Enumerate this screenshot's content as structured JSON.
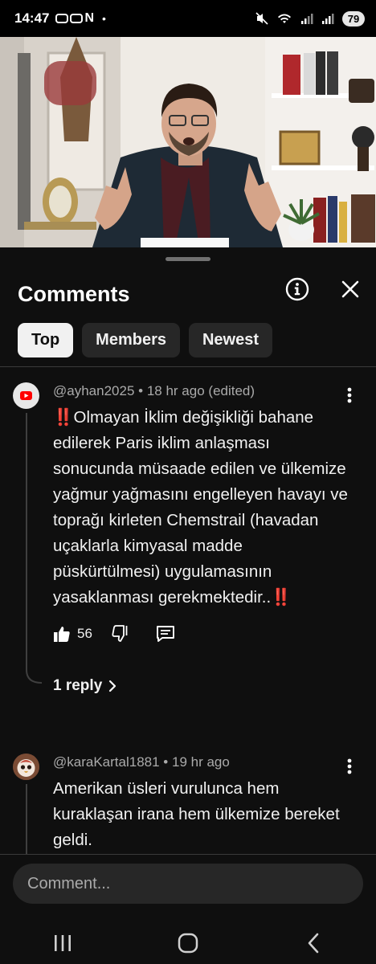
{
  "status_bar": {
    "time": "14:47",
    "app_glyphs": "N",
    "dot": "•",
    "battery": "79"
  },
  "sheet": {
    "title": "Comments",
    "tabs": [
      {
        "label": "Top",
        "active": true
      },
      {
        "label": "Members",
        "active": false
      },
      {
        "label": "Newest",
        "active": false
      }
    ]
  },
  "comments": [
    {
      "author": "@ayhan2025",
      "age": "18 hr ago",
      "edited": "(edited)",
      "emoji_lead": "‼️",
      "text": "Olmayan İklim değişikliği bahane edilerek Paris iklim anlaşması sonucunda müsaade edilen ve ülkemize yağmur yağmasını engelleyen havayı ve toprağı kirleten Chemstrail (havadan uçaklarla kimyasal madde püskürtülmesi) uygulamasının yasaklanması gerekmektedir..",
      "emoji_trail": "‼️",
      "likes": "56",
      "replies_label": "1 reply"
    },
    {
      "author": "@karaKartal1881",
      "age": "19 hr ago",
      "text": "Amerikan üsleri vurulunca hem kuraklaşan irana hem ülkemize bereket geldi."
    }
  ],
  "composer": {
    "placeholder": "Comment..."
  },
  "colors": {
    "background": "#0f0f0f",
    "chip": "#272727",
    "active_chip": "#f1f1f1",
    "meta_text": "#aaaaaa",
    "emoji_red": "#e0243a"
  }
}
